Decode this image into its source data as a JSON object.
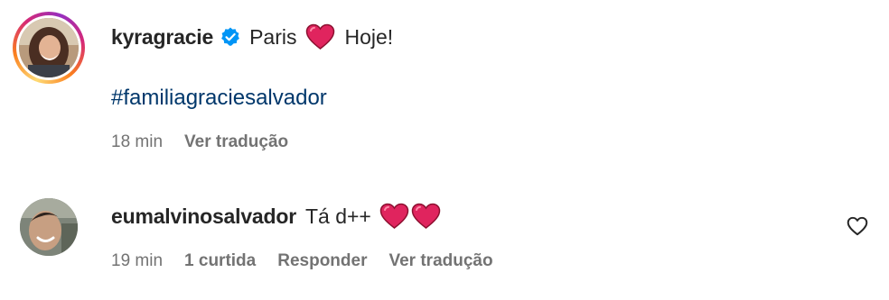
{
  "caption": {
    "username": "kyragracie",
    "verified": true,
    "text_before_emoji": "Paris",
    "emoji": "red-heart",
    "text_after_emoji": "Hoje!",
    "hashtag": "#familiagraciesalvador",
    "time": "18 min",
    "translate_label": "Ver tradução"
  },
  "reply": {
    "username": "eumalvinosalvador",
    "text": "Tá d++",
    "emojis": [
      "red-heart",
      "red-heart"
    ],
    "time": "19 min",
    "likes_label": "1 curtida",
    "reply_label": "Responder",
    "translate_label": "Ver tradução",
    "like_icon": "heart-outline-icon"
  },
  "colors": {
    "text": "#262626",
    "meta": "#737373",
    "hashtag": "#00376b",
    "verified": "#0095f6",
    "heart": "#e0245e"
  }
}
